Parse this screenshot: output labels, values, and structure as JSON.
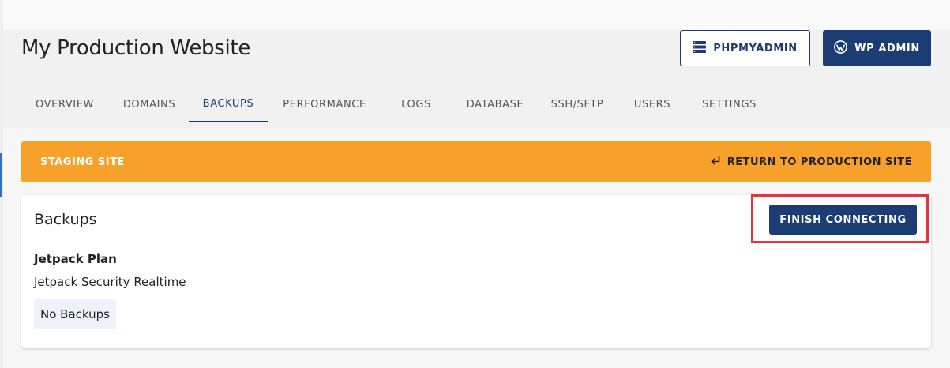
{
  "site": {
    "title": "My Production Website"
  },
  "header_buttons": {
    "phpmyadmin": "PHPMYADMIN",
    "wp_admin": "WP ADMIN"
  },
  "tabs": [
    {
      "label": "OVERVIEW"
    },
    {
      "label": "DOMAINS"
    },
    {
      "label": "BACKUPS",
      "active": true
    },
    {
      "label": "PERFORMANCE"
    },
    {
      "label": "LOGS"
    },
    {
      "label": "DATABASE"
    },
    {
      "label": "SSH/SFTP"
    },
    {
      "label": "USERS"
    },
    {
      "label": "SETTINGS"
    }
  ],
  "banner": {
    "label": "STAGING SITE",
    "link": "RETURN TO PRODUCTION SITE",
    "link_icon": "return-arrow-icon",
    "color": "#f7a02a"
  },
  "backups": {
    "title": "Backups",
    "action": "FINISH CONNECTING",
    "plan_label": "Jetpack Plan",
    "plan_value": "Jetpack Security Realtime",
    "status": "No Backups"
  },
  "colors": {
    "primary": "#1b3d73",
    "highlight": "#e8333c",
    "banner": "#f7a02a"
  }
}
